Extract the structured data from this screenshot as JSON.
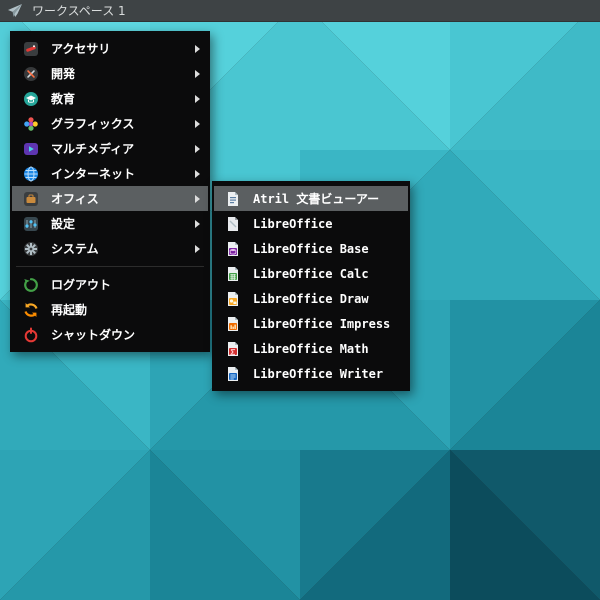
{
  "taskbar": {
    "workspace_label": "ワークスペース 1"
  },
  "main_menu": {
    "items": [
      {
        "label": "アクセサリ",
        "icon": "accessories-icon",
        "has_submenu": true,
        "highlighted": false
      },
      {
        "label": "開発",
        "icon": "development-icon",
        "has_submenu": true,
        "highlighted": false
      },
      {
        "label": "教育",
        "icon": "education-icon",
        "has_submenu": true,
        "highlighted": false
      },
      {
        "label": "グラフィックス",
        "icon": "graphics-icon",
        "has_submenu": true,
        "highlighted": false
      },
      {
        "label": "マルチメディア",
        "icon": "multimedia-icon",
        "has_submenu": true,
        "highlighted": false
      },
      {
        "label": "インターネット",
        "icon": "internet-icon",
        "has_submenu": true,
        "highlighted": false
      },
      {
        "label": "オフィス",
        "icon": "office-icon",
        "has_submenu": true,
        "highlighted": true
      },
      {
        "label": "設定",
        "icon": "settings-icon",
        "has_submenu": true,
        "highlighted": false
      },
      {
        "label": "システム",
        "icon": "system-icon",
        "has_submenu": true,
        "highlighted": false
      }
    ],
    "actions": [
      {
        "label": "ログアウト",
        "icon": "logout-icon"
      },
      {
        "label": "再起動",
        "icon": "restart-icon"
      },
      {
        "label": "シャットダウン",
        "icon": "shutdown-icon"
      }
    ]
  },
  "office_submenu": {
    "items": [
      {
        "label": "Atril 文書ビューアー",
        "icon": "atril-icon",
        "highlighted": true
      },
      {
        "label": "LibreOffice",
        "icon": "libreoffice-icon",
        "highlighted": false
      },
      {
        "label": "LibreOffice Base",
        "icon": "libreoffice-base-icon",
        "highlighted": false
      },
      {
        "label": "LibreOffice Calc",
        "icon": "libreoffice-calc-icon",
        "highlighted": false
      },
      {
        "label": "LibreOffice Draw",
        "icon": "libreoffice-draw-icon",
        "highlighted": false
      },
      {
        "label": "LibreOffice Impress",
        "icon": "libreoffice-impress-icon",
        "highlighted": false
      },
      {
        "label": "LibreOffice Math",
        "icon": "libreoffice-math-icon",
        "highlighted": false
      },
      {
        "label": "LibreOffice Writer",
        "icon": "libreoffice-writer-icon",
        "highlighted": false
      }
    ]
  },
  "colors": {
    "taskbar_bg": "#3e4345",
    "menu_bg": "#0b0b0c",
    "menu_highlight": "#5b5f61",
    "menu_text": "#ffffff",
    "desktop_light": "#5ed8e1",
    "desktop_dark": "#0c4c5c"
  }
}
